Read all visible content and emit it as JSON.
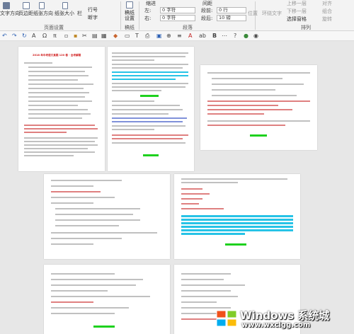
{
  "ribbon": {
    "text_direction": "文字方向",
    "margins": "页边距",
    "orientation": "纸张方向",
    "size": "纸张大小",
    "columns": "栏",
    "line_numbers": "行号",
    "hyphenation": "断字",
    "page_setup_group": "页面设置",
    "draft_paper": "稿纸设置",
    "draft_group": "稿纸",
    "indent_header": "缩进",
    "indent_left_label": "左:",
    "indent_left_value": "0 字符",
    "indent_right_label": "右:",
    "indent_right_value": "0 字符",
    "spacing_header": "间距",
    "space_before_label": "段前:",
    "space_before_value": "0 行",
    "space_after_label": "段后:",
    "space_after_value": "10 磅",
    "paragraph_group": "段落",
    "position": "位置",
    "wrap_text": "环绕文字",
    "bring_forward": "上移一层",
    "send_backward": "下移一层",
    "selection_pane": "选择窗格",
    "align": "对齐",
    "group": "组合",
    "rotate": "旋转",
    "arrange_group": "排列"
  },
  "qat": {
    "icons": [
      "undo-icon",
      "redo-icon",
      "refresh-icon",
      "font-icon",
      "omega-icon",
      "pi-icon",
      "new-doc-icon",
      "page-icon",
      "cut-icon",
      "format-icon",
      "table-icon",
      "eraser-icon",
      "shape-icon",
      "text-icon",
      "print-icon",
      "save-icon",
      "zoom-icon",
      "indent-icon",
      "letter-a-icon",
      "ab-icon",
      "bold-icon",
      "more-icon",
      "help-icon",
      "circle-icon",
      "record-icon"
    ]
  },
  "pages": {
    "p1_title": "2018 年中考语文真题 120 卷 · 全考解题"
  },
  "watermark": {
    "title": "Windows 系统城",
    "url": "www.wxclgg.com"
  },
  "colors": {
    "ribbon_bg": "#f3f3f3",
    "canvas_bg": "#e7e7e7",
    "highlight_cyan": "#27c3e6",
    "highlight_green": "#1ed11e",
    "red_text": "#d12020"
  }
}
